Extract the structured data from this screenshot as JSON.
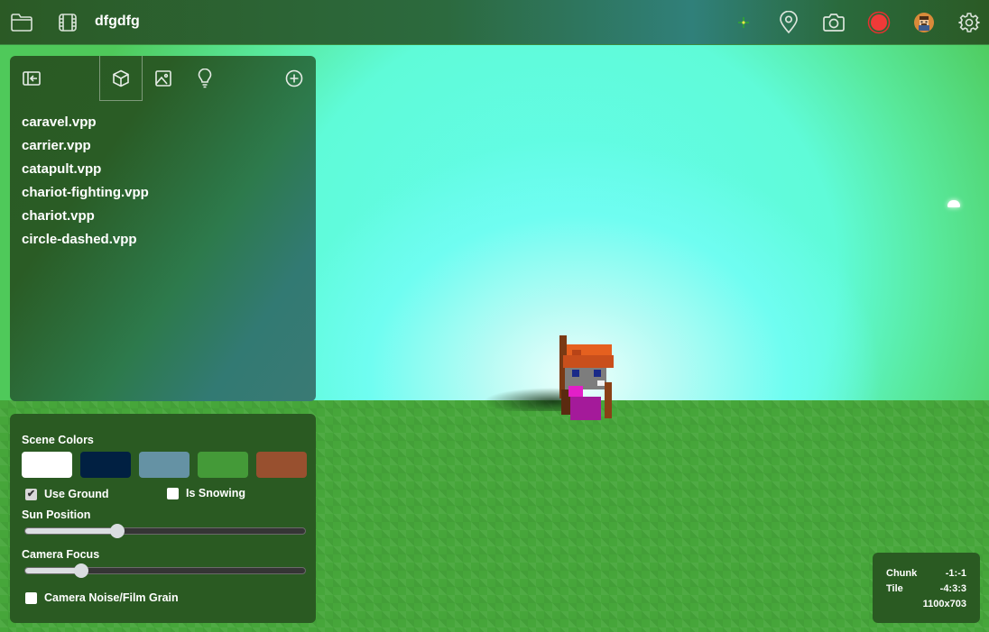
{
  "topbar": {
    "title": "dfgdfg",
    "left_icons": [
      "folder-icon",
      "film-icon"
    ],
    "right_icons": [
      "crosshair-indicator",
      "map-pin-icon",
      "camera-icon",
      "record-icon",
      "avatar",
      "settings-icon"
    ],
    "record_color": "#e8302f"
  },
  "asset_panel": {
    "tabs": [
      {
        "name": "collapse-panel",
        "icon": "sidebar-collapse-icon"
      },
      {
        "name": "models",
        "icon": "cube-icon",
        "active": true
      },
      {
        "name": "images",
        "icon": "image-icon"
      },
      {
        "name": "lights",
        "icon": "lightbulb-icon"
      }
    ],
    "add_icon": "plus-circle-icon",
    "files": [
      "caravel.vpp",
      "carrier.vpp",
      "catapult.vpp",
      "chariot-fighting.vpp",
      "chariot.vpp",
      "circle-dashed.vpp"
    ]
  },
  "scene_panel": {
    "scene_colors_label": "Scene Colors",
    "scene_colors": [
      "#ffffff",
      "#012042",
      "#6592a4",
      "#449a38",
      "#98502f"
    ],
    "use_ground": {
      "label": "Use Ground",
      "checked": true
    },
    "is_snowing": {
      "label": "Is Snowing",
      "checked": false
    },
    "sun_position": {
      "label": "Sun Position",
      "value_pct": 33
    },
    "camera_focus": {
      "label": "Camera Focus",
      "value_pct": 20
    },
    "camera_noise": {
      "label": "Camera Noise/Film Grain",
      "checked": false
    }
  },
  "info_box": {
    "chunk_label": "Chunk",
    "chunk_value": "-1:-1",
    "tile_label": "Tile",
    "tile_value": "-4:3:3",
    "resolution": "1100x703"
  }
}
